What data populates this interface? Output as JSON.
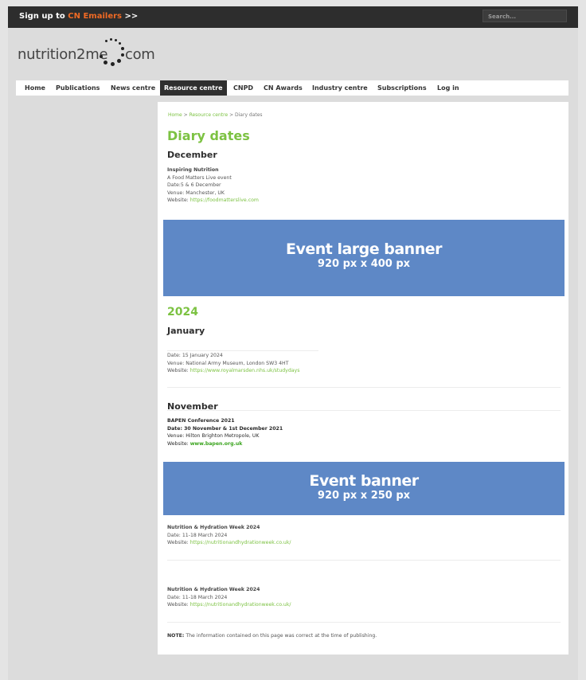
{
  "topbar": {
    "signup_prefix": "Sign up to ",
    "signup_highlight": "CN Emailers",
    "signup_suffix": " >>",
    "search_placeholder": "Search..."
  },
  "logo": {
    "text_left": "nutrition2me",
    "text_right": "com"
  },
  "nav": {
    "items": [
      {
        "label": "Home"
      },
      {
        "label": "Publications"
      },
      {
        "label": "News centre"
      },
      {
        "label": "Resource centre"
      },
      {
        "label": "CNPD"
      },
      {
        "label": "CN Awards"
      },
      {
        "label": "Industry centre"
      },
      {
        "label": "Subscriptions"
      },
      {
        "label": "Log in"
      }
    ],
    "active": "Resource centre"
  },
  "breadcrumb": {
    "home": "Home",
    "sep1": " > ",
    "resource": "Resource centre",
    "sep2": " > ",
    "current": "Diary dates"
  },
  "page_title": "Diary dates",
  "sections": {
    "december": {
      "heading": "December",
      "event": {
        "title": "Inspiring Nutrition",
        "line1": "A Food Matters Live event",
        "line2": "Date:5 & 6 December",
        "line3": "Venue: Manchester, UK",
        "website_label": "Website: ",
        "website": "https://foodmatterslive.com"
      }
    },
    "banner_large": {
      "title": "Event large banner",
      "size": "920 px x 400 px"
    },
    "year": "2024",
    "january": {
      "heading": "January",
      "event": {
        "line1": "Date: 15 January 2024",
        "line2": "Venue: National Army Museum, London SW3 4HT",
        "website_label": "Website: ",
        "website": "https://www.royalmarsden.nhs.uk/studydays"
      }
    },
    "november": {
      "heading": "November",
      "event": {
        "title": "BAPEN Conference 2021",
        "line1": "Date: 30 November & 1st December 2021",
        "line2": "Venue: Hilton Brighton Metropole, UK",
        "website_label": "Website: ",
        "website": "www.bapen.org.uk"
      }
    },
    "banner_small": {
      "title": "Event banner",
      "size": "920 px x 250 px"
    },
    "hydration1": {
      "title": "Nutrition & Hydration Week 2024",
      "line1": "Date: 11-18 March 2024",
      "website_label": "Website: ",
      "website": "https://nutritionandhydrationweek.co.uk/"
    },
    "hydration2": {
      "title": "Nutrition & Hydration Week 2024",
      "line1": "Date: 11-18 March 2024",
      "website_label": "Website: ",
      "website": "https://nutritionandhydrationweek.co.uk/"
    }
  },
  "note": {
    "label": "NOTE:",
    "text": " The information contained on this page was correct at the time of publishing."
  },
  "colors": {
    "accent_green": "#7cc242",
    "banner_blue": "#5e88c6",
    "topbar": "#2d2d2d",
    "signup_orange": "#f06a24"
  }
}
